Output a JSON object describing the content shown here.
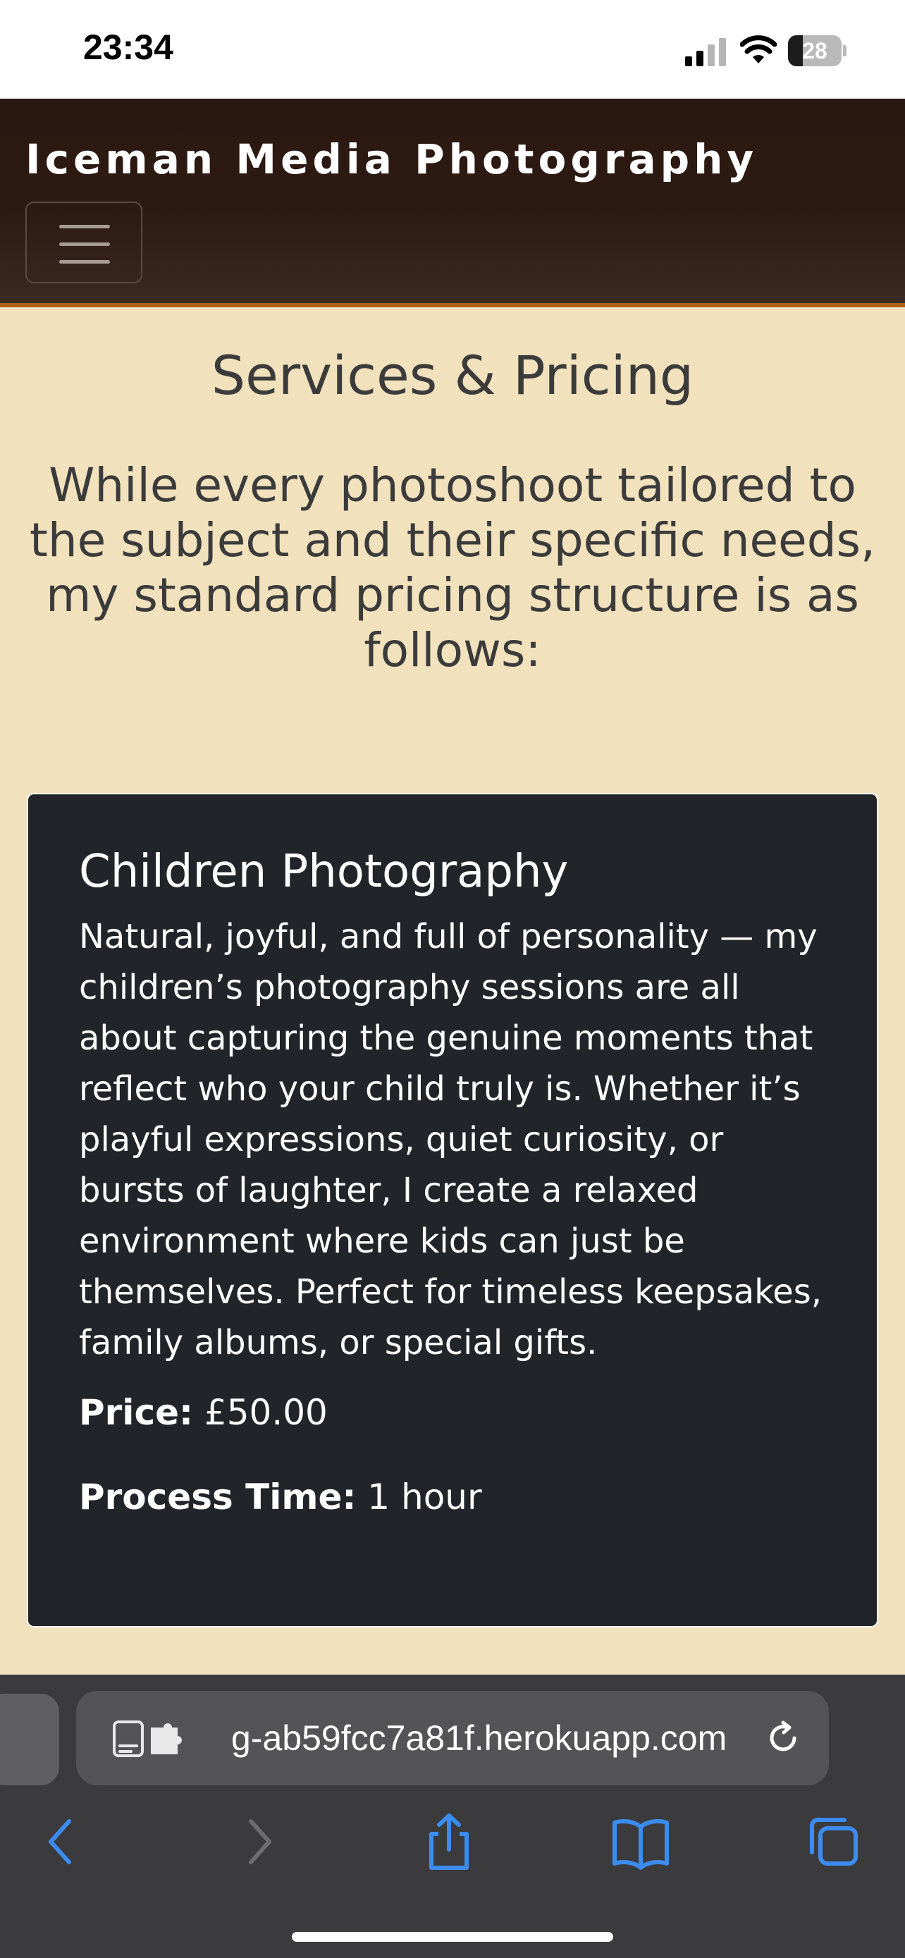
{
  "status_bar": {
    "time": "23:34",
    "battery_level": "28",
    "battery_fraction": 0.28
  },
  "navbar": {
    "brand": "Iceman Media Photography",
    "toggler_icon": "hamburger-icon"
  },
  "main": {
    "title": "Services & Pricing",
    "intro": "While every photoshoot tailored to the subject and their specific needs, my standard pricing structure is as follows:",
    "service": {
      "title": "Children Photography",
      "description": "Natural, joyful, and full of personality — my children’s photography sessions are all about capturing the genuine moments that reflect who your child truly is. Whether it’s playful expressions, quiet curiosity, or bursts of laughter, I create a relaxed environment where kids can just be themselves. Perfect for timeless keepsakes, family albums, or special gifts.",
      "price_label": "Price:",
      "price_value": "£50.00",
      "time_label": "Process Time:",
      "time_value": "1 hour"
    }
  },
  "browser": {
    "url": "g-ab59fcc7a81f.herokuapp.com",
    "accent_color": "#3c8cf0",
    "disabled_color": "#6d6d70",
    "toolbar_icons": [
      "back-icon",
      "forward-icon",
      "share-icon",
      "bookmarks-icon",
      "tabs-icon"
    ]
  }
}
